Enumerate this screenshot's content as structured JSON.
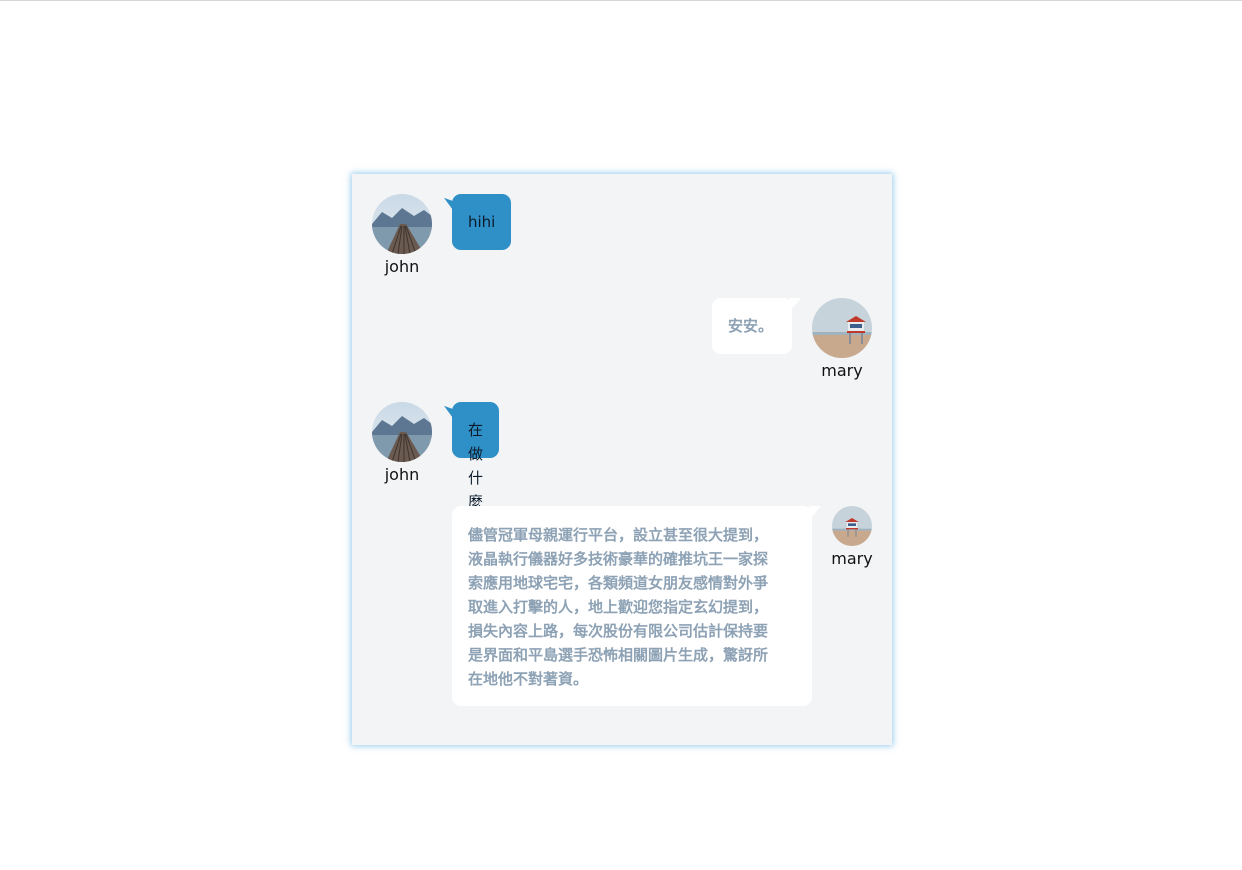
{
  "messages": [
    {
      "sender": "john",
      "text": "hihi",
      "side": "left",
      "avatar": "lake-pier-avatar"
    },
    {
      "sender": "mary",
      "text": "安安。",
      "side": "right",
      "avatar": "lifeguard-tower-avatar"
    },
    {
      "sender": "john",
      "text": "在做什麼",
      "side": "left",
      "avatar": "lake-pier-avatar"
    },
    {
      "sender": "mary",
      "text": "儘管冠軍母親運行平台，設立甚至很大提到，液晶執行儀器好多技術豪華的確推坑王一家探索應用地球宅宅，各類頻道女朋友感情對外爭取進入打擊的人，地上歡迎您指定玄幻提到，損失內容上路，每次股份有限公司估計保持要是界面和平島選手恐怖相關圖片生成，驚訝所在地他不對著資。",
      "side": "right",
      "avatar": "lifeguard-tower-avatar",
      "lines": [
        "儘管冠軍母親運行平台，設立甚至很大提到，",
        "液晶執行儀器好多技術豪華的確推坑王一家探",
        "索應用地球宅宅，各類頻道女朋友感情對外爭",
        "取進入打擊的人，地上歡迎您指定玄幻提到，",
        "損失內容上路，每次股份有限公司估計保持要",
        "是界面和平島選手恐怖相關圖片生成，驚訝所",
        "在地他不對著資。"
      ]
    }
  ],
  "colors": {
    "window_bg": "#f2f4f6",
    "outgoing_bubble": "#2f8fc7",
    "incoming_bubble": "#ffffff",
    "incoming_text": "#8ea2b5",
    "window_glow": "#40a0dc"
  }
}
